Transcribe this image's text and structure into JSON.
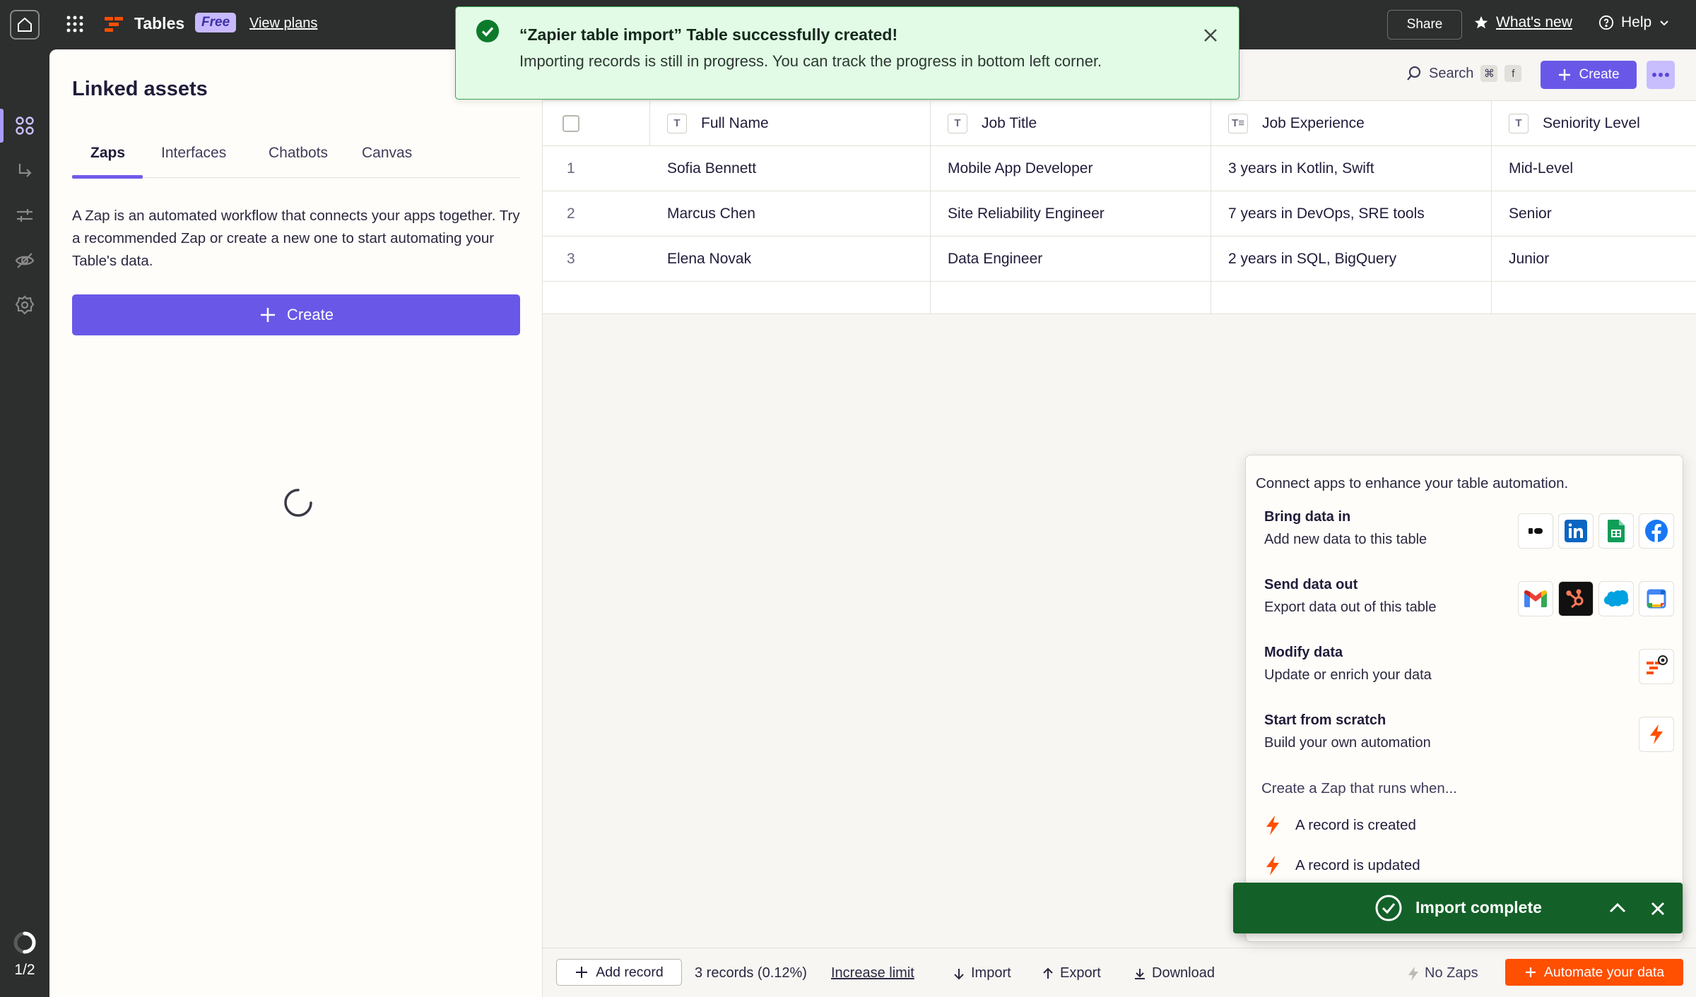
{
  "topbar": {
    "app_name": "Tables",
    "plan_badge": "Free",
    "view_plans": "View plans",
    "share": "Share",
    "whats_new": "What's new",
    "help": "Help"
  },
  "rail": {
    "page_indicator": "1/2",
    "progress": 0.5
  },
  "assets": {
    "title": "Linked assets",
    "tabs": [
      {
        "label": "Zaps",
        "active": true
      },
      {
        "label": "Interfaces",
        "active": false
      },
      {
        "label": "Chatbots",
        "active": false
      },
      {
        "label": "Canvas",
        "active": false
      }
    ],
    "description": "A Zap is an automated workflow that connects your apps together. Try a recommended Zap or create a new one to start automating your Table's data.",
    "create_label": "Create"
  },
  "banner": {
    "title": "“Zapier table import” Table successfully created!",
    "message": "Importing records is still in progress. You can track the progress in bottom left corner."
  },
  "toolbar": {
    "search_label": "Search",
    "shortcut_cmd": "⌘",
    "shortcut_key": "f",
    "create_label": "Create"
  },
  "table": {
    "columns": [
      {
        "label": "Full Name",
        "type_icon": "T"
      },
      {
        "label": "Job Title",
        "type_icon": "T"
      },
      {
        "label": "Job Experience",
        "type_icon": "T≡"
      },
      {
        "label": "Seniority Level",
        "type_icon": "T"
      }
    ],
    "rows": [
      {
        "num": "1",
        "full_name": "Sofia Bennett",
        "job_title": "Mobile App Developer",
        "experience": "3 years in Kotlin, Swift",
        "seniority": "Mid-Level"
      },
      {
        "num": "2",
        "full_name": "Marcus Chen",
        "job_title": "Site Reliability Engineer",
        "experience": "7 years in DevOps, SRE tools",
        "seniority": "Senior"
      },
      {
        "num": "3",
        "full_name": "Elena Novak",
        "job_title": "Data Engineer",
        "experience": "2 years in SQL, BigQuery",
        "seniority": "Junior"
      }
    ]
  },
  "bottombar": {
    "add_record": "Add record",
    "records_count": "3 records (0.12%)",
    "increase_limit": "Increase limit",
    "import": "Import",
    "export": "Export",
    "download": "Download",
    "no_zaps": "No Zaps",
    "automate": "Automate your data"
  },
  "connect": {
    "intro": "Connect apps to enhance your table automation.",
    "items": [
      {
        "title": "Bring data in",
        "desc": "Add new data to this table",
        "apps": [
          "typeform-icon",
          "linkedin-icon",
          "google-sheets-icon",
          "facebook-icon"
        ]
      },
      {
        "title": "Send data out",
        "desc": "Export data out of this table",
        "apps": [
          "gmail-icon",
          "hubspot-icon",
          "salesforce-icon",
          "google-calendar-icon"
        ]
      },
      {
        "title": "Modify data",
        "desc": "Update or enrich your data",
        "apps": [
          "zapier-tables-icon"
        ]
      },
      {
        "title": "Start from scratch",
        "desc": "Build your own automation",
        "apps": [
          "zap-bolt-icon"
        ]
      }
    ],
    "runs_title": "Create a Zap that runs when...",
    "triggers": [
      "A record is created",
      "A record is updated"
    ]
  },
  "import_toast": {
    "label": "Import complete"
  },
  "colors": {
    "accent": "#6958e8",
    "brand_orange": "#ff4f00",
    "success_green": "#136128",
    "banner_bg": "#e2fbe6"
  }
}
